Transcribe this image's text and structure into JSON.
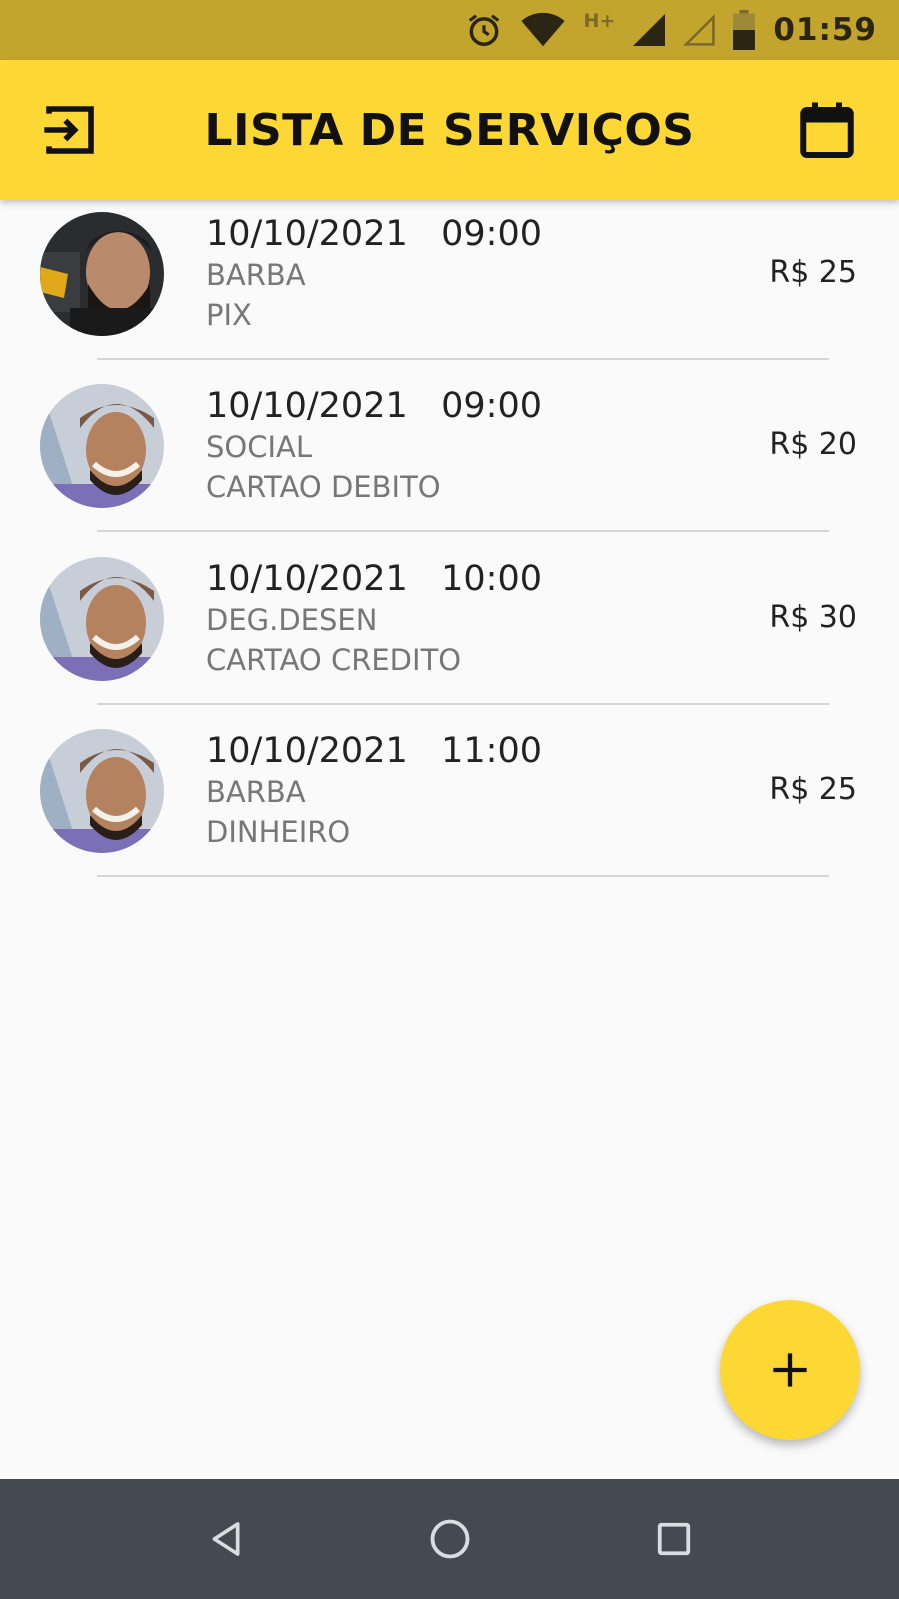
{
  "status_bar": {
    "time": "01:59",
    "network_label": "H+",
    "icons": [
      "alarm-icon",
      "wifi-icon",
      "signal-icon",
      "signal-empty-icon",
      "battery-icon"
    ]
  },
  "header": {
    "title": "LISTA DE SERVIÇOS",
    "left_icon": "logout-icon",
    "right_icon": "calendar-icon"
  },
  "services": [
    {
      "date": "10/10/2021",
      "time": "09:00",
      "service": "BARBA",
      "payment": "PIX",
      "price": "R$ 25",
      "avatar": "barber-1"
    },
    {
      "date": "10/10/2021",
      "time": "09:00",
      "service": "SOCIAL",
      "payment": "CARTAO DEBITO",
      "price": "R$ 20",
      "avatar": "barber-2"
    },
    {
      "date": "10/10/2021",
      "time": "10:00",
      "service": "DEG.DESEN",
      "payment": "CARTAO CREDITO",
      "price": "R$ 30",
      "avatar": "barber-2"
    },
    {
      "date": "10/10/2021",
      "time": "11:00",
      "service": "BARBA",
      "payment": "DINHEIRO",
      "price": "R$ 25",
      "avatar": "barber-2"
    }
  ],
  "fab": {
    "icon": "plus-icon"
  },
  "nav": {
    "icons": [
      "back-icon",
      "home-icon",
      "recents-icon"
    ]
  },
  "colors": {
    "status_bar": "#c3a42d",
    "app_bar": "#fdd835",
    "nav_bar": "#434a52"
  }
}
